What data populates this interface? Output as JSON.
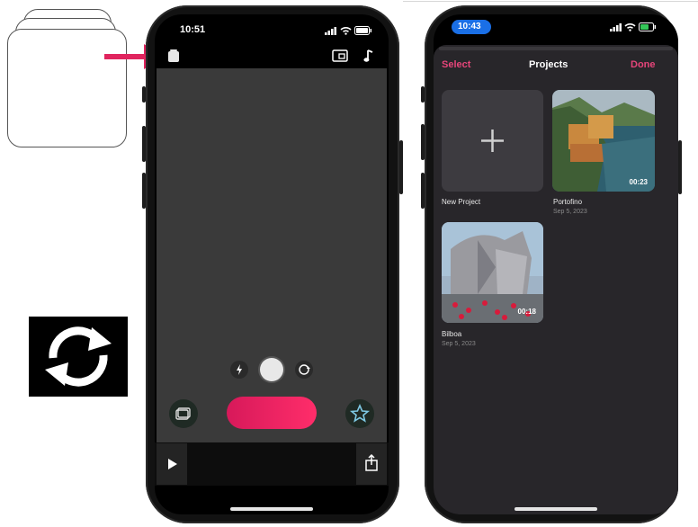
{
  "left_phone": {
    "time": "10:51",
    "camera_controls": [
      "flash-icon",
      "shutter",
      "flip-camera-icon"
    ],
    "bottom_icons": [
      "photo-library-icon",
      "record-button",
      "star-icon"
    ],
    "bottom_bar": [
      "play-icon",
      "share-icon"
    ]
  },
  "right_phone": {
    "time": "10:43",
    "header": {
      "select": "Select",
      "title": "Projects",
      "done": "Done"
    },
    "projects": [
      {
        "name": "New Project",
        "date": "",
        "duration": ""
      },
      {
        "name": "Portofino",
        "date": "Sep 5, 2023",
        "duration": "00:23"
      },
      {
        "name": "Bilboa",
        "date": "Sep 5, 2023",
        "duration": "00:18"
      }
    ]
  },
  "colors": {
    "accent": "#e0245e",
    "record": "#ff2d6a",
    "header_link": "#e6457a"
  }
}
